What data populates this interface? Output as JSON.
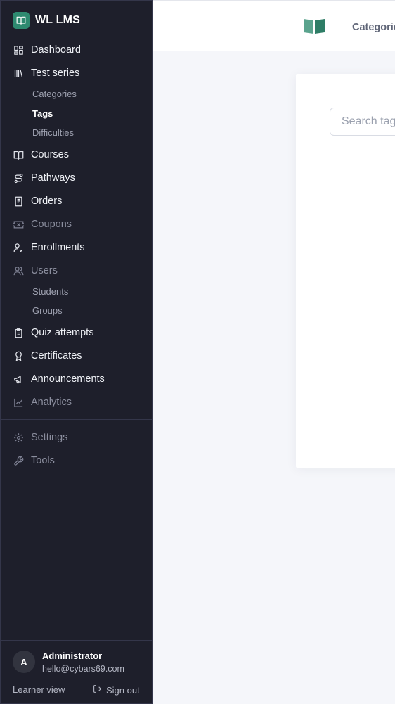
{
  "brand": {
    "name": "WL LMS",
    "color": "#2e8a70"
  },
  "nav": {
    "dashboard": "Dashboard",
    "test_series": "Test series",
    "categories": "Categories",
    "tags": "Tags",
    "difficulties": "Difficulties",
    "courses": "Courses",
    "pathways": "Pathways",
    "orders": "Orders",
    "coupons": "Coupons",
    "enrollments": "Enrollments",
    "users": "Users",
    "students": "Students",
    "groups": "Groups",
    "quiz_attempts": "Quiz attempts",
    "certificates": "Certificates",
    "announcements": "Announcements",
    "analytics": "Analytics",
    "settings": "Settings",
    "tools": "Tools"
  },
  "user": {
    "initial": "A",
    "name": "Administrator",
    "email": "hello@cybars69.com",
    "learner_view": "Learner view",
    "sign_out": "Sign out"
  },
  "topbar": {
    "link": "Categories"
  },
  "main": {
    "search_placeholder": "Search tags"
  }
}
